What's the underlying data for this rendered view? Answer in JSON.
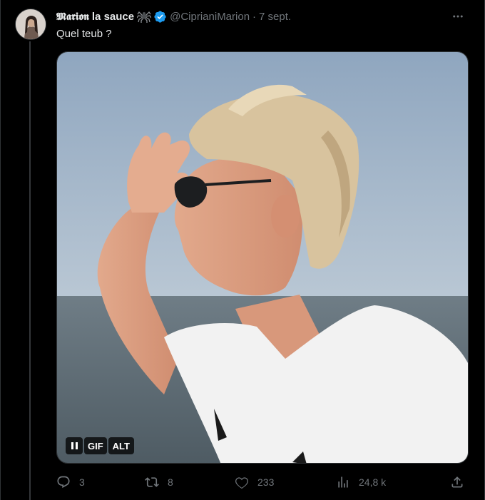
{
  "tweet": {
    "display_name_styled": "𝕸𝖆𝖗𝖎𝖔𝖓",
    "display_name_rest": "la sauce",
    "handle": "@CiprianiMarion",
    "separator": "·",
    "date": "7 sept.",
    "text": "Quel teub ?",
    "media": {
      "pause_label": "",
      "gif_label": "GIF",
      "alt_label": "ALT"
    },
    "actions": {
      "replies": "3",
      "retweets": "8",
      "likes": "233",
      "views": "24,8 k"
    }
  },
  "colors": {
    "background": "#000000",
    "text": "#e7e9ea",
    "secondary": "#71767b",
    "verified": "#1d9bf0",
    "border": "#2f3336"
  }
}
